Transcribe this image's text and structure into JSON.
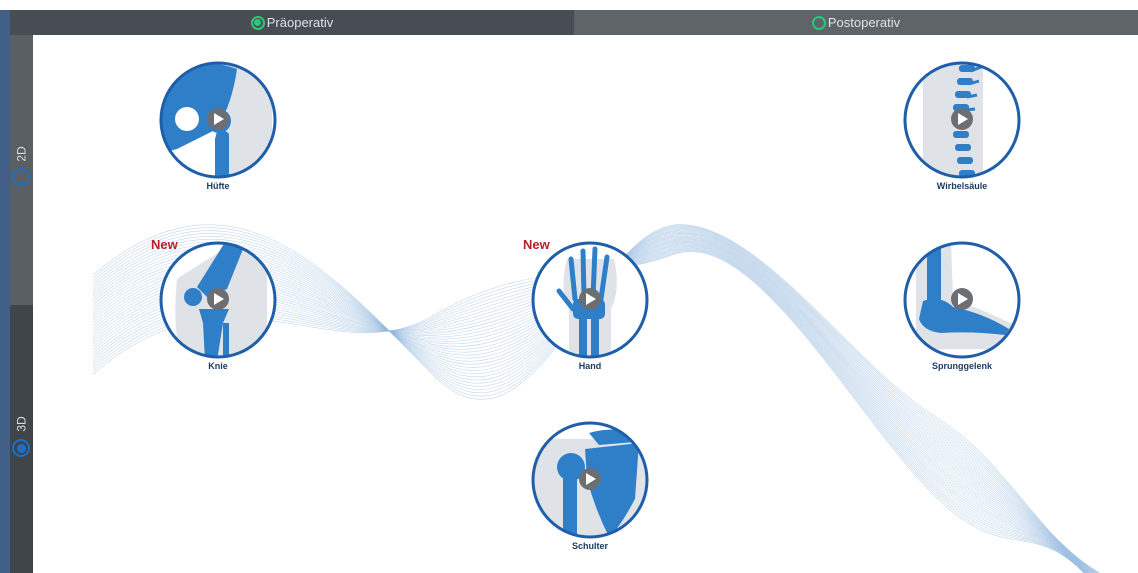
{
  "tabs": [
    {
      "label": "Präoperativ",
      "selected": true
    },
    {
      "label": "Postoperativ",
      "selected": false
    }
  ],
  "sidebar": {
    "items": [
      {
        "label": "2D",
        "selected": false
      },
      {
        "label": "3D",
        "selected": true
      }
    ]
  },
  "joints": [
    {
      "label": "Hüfte",
      "icon": "hip-bone-icon",
      "badge": ""
    },
    {
      "label": "Wirbelsäule",
      "icon": "spine-bone-icon",
      "badge": ""
    },
    {
      "label": "Knie",
      "icon": "knee-bone-icon",
      "badge": "New"
    },
    {
      "label": "Hand",
      "icon": "hand-bone-icon",
      "badge": "New"
    },
    {
      "label": "Sprunggelenk",
      "icon": "ankle-bone-icon",
      "badge": ""
    },
    {
      "label": "Schulter",
      "icon": "shoulder-bone-icon",
      "badge": ""
    }
  ],
  "colors": {
    "accent": "#27c97a",
    "bone": "#2f7fc8",
    "ring": "#1f5ea8",
    "badge": "#b8202a",
    "tab_bar": "#474d52",
    "sidebar": "#3f4549"
  }
}
